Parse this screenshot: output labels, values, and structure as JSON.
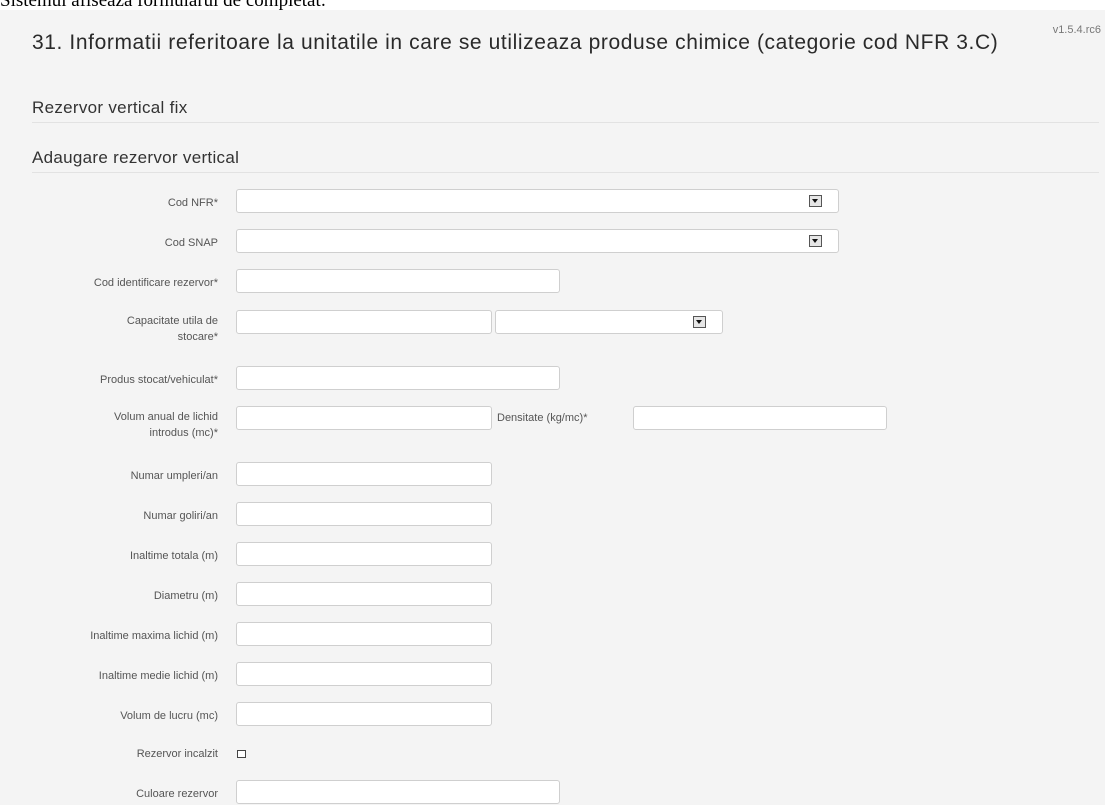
{
  "caption": "Sistemul afiseaza formularul de completat:",
  "version": "v1.5.4.rc6",
  "title": "31. Informatii referitoare la unitatile in care se utilizeaza produse chimice (categorie cod NFR 3.C)",
  "section": "Rezervor vertical fix",
  "subsection": "Adaugare rezervor vertical",
  "fields": {
    "cod_nfr": {
      "label": "Cod NFR*",
      "value": ""
    },
    "cod_snap": {
      "label": "Cod SNAP",
      "value": ""
    },
    "cod_identificare": {
      "label": "Cod identificare rezervor*",
      "value": ""
    },
    "capacitate": {
      "label_line1": "Capacitate utila de",
      "label_line2": "stocare*",
      "value": "",
      "unit_value": ""
    },
    "produs": {
      "label": "Produs stocat/vehiculat*",
      "value": ""
    },
    "volum_anual": {
      "label_line1": "Volum anual de lichid",
      "label_line2": "introdus (mc)*",
      "value": ""
    },
    "densitate": {
      "label": "Densitate (kg/mc)*",
      "value": ""
    },
    "numar_umpleri": {
      "label": "Numar umpleri/an",
      "value": ""
    },
    "numar_goliri": {
      "label": "Numar goliri/an",
      "value": ""
    },
    "inaltime_totala": {
      "label": "Inaltime totala (m)",
      "value": ""
    },
    "diametru": {
      "label": "Diametru (m)",
      "value": ""
    },
    "inaltime_maxima": {
      "label": "Inaltime maxima lichid (m)",
      "value": ""
    },
    "inaltime_medie": {
      "label": "Inaltime medie lichid (m)",
      "value": ""
    },
    "volum_lucru": {
      "label": "Volum de lucru (mc)",
      "value": ""
    },
    "rezervor_incalzit": {
      "label": "Rezervor incalzit",
      "checked": false
    },
    "culoare": {
      "label": "Culoare rezervor",
      "value": ""
    }
  }
}
